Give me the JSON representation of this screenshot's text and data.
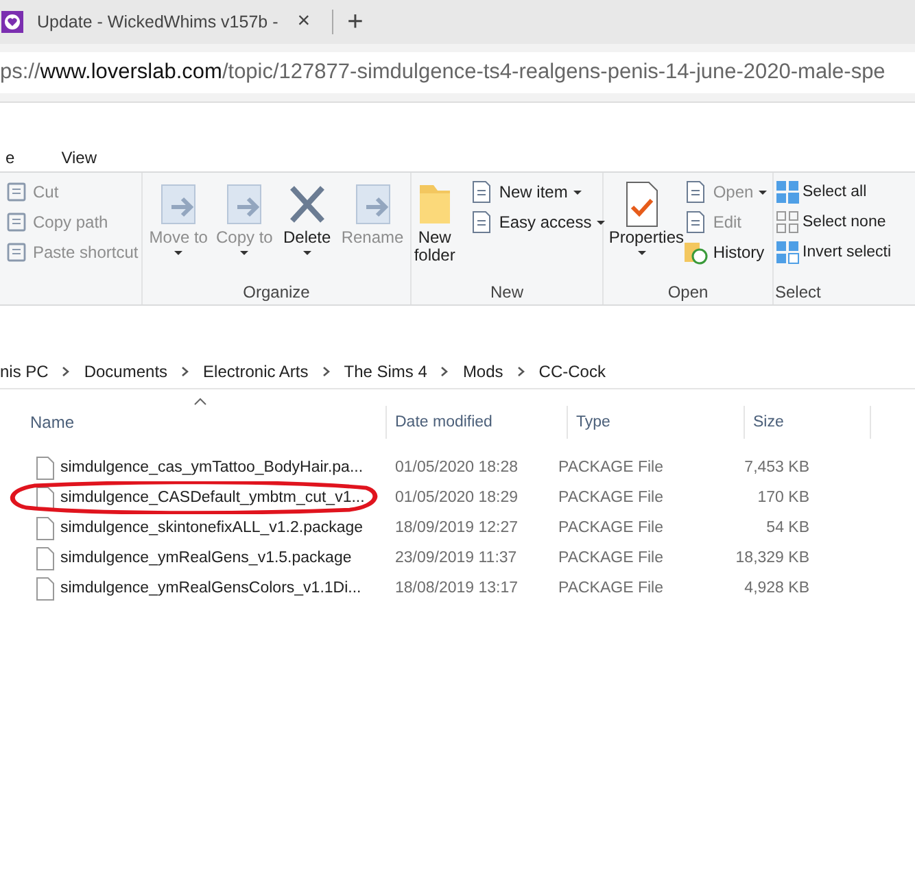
{
  "browser": {
    "tab": {
      "title": "Update - WickedWhims v157b -",
      "close": "×"
    },
    "new_tab": "+",
    "address": {
      "scheme": "ps://",
      "host": "www.loverslab.com",
      "path": "/topic/127877-simdulgence-ts4-realgens-penis-14-june-2020-male-spe"
    }
  },
  "ribbon_tabs": [
    {
      "label": "e",
      "selected": false
    },
    {
      "label": "View",
      "selected": false
    }
  ],
  "ribbon_groups": [
    {
      "items": [
        {
          "kind": "small",
          "label": "Cut",
          "disabled": true
        },
        {
          "kind": "small",
          "label": "Copy path",
          "disabled": true
        },
        {
          "kind": "small",
          "label": "Paste shortcut",
          "disabled": true
        }
      ]
    },
    {
      "label": "Organize",
      "items": [
        {
          "kind": "large",
          "label": "Move to",
          "caret": true,
          "disabled": true
        },
        {
          "kind": "large",
          "label": "Copy to",
          "caret": true,
          "disabled": true
        },
        {
          "kind": "large",
          "label": "Delete",
          "caret": true,
          "disabled": false
        },
        {
          "kind": "large",
          "label": "Rename",
          "caret": false,
          "disabled": true
        }
      ]
    },
    {
      "label": "New",
      "items": [
        {
          "kind": "large",
          "label": "New folder",
          "caret": false,
          "disabled": false
        },
        {
          "kind": "stack",
          "items": [
            {
              "label": "New item",
              "caret": true,
              "disabled": false
            },
            {
              "label": "Easy access",
              "caret": true,
              "disabled": false
            }
          ]
        }
      ]
    },
    {
      "label": "Open",
      "items": [
        {
          "kind": "large",
          "label": "Properties",
          "caret": true,
          "disabled": false
        },
        {
          "kind": "stack",
          "items": [
            {
              "label": "Open",
              "caret": true,
              "disabled": true
            },
            {
              "label": "Edit",
              "caret": false,
              "disabled": true
            },
            {
              "label": "History",
              "caret": false,
              "disabled": false
            }
          ]
        }
      ]
    },
    {
      "label": "Select",
      "items": [
        {
          "kind": "stack",
          "items": [
            {
              "label": "Select all",
              "caret": false,
              "disabled": false
            },
            {
              "label": "Select none",
              "caret": false,
              "disabled": false
            },
            {
              "label": "Invert selecti",
              "caret": false,
              "disabled": false
            }
          ]
        }
      ]
    }
  ],
  "breadcrumb": [
    "nis PC",
    "Documents",
    "Electronic Arts",
    "The Sims 4",
    "Mods",
    "CC-Cock"
  ],
  "table": {
    "columns": [
      "Name",
      "Date modified",
      "Type",
      "Size"
    ],
    "rows": [
      {
        "name": "simdulgence_cas_ymTattoo_BodyHair.pa...",
        "date": "01/05/2020 18:28",
        "type": "PACKAGE File",
        "size": "7,453 KB",
        "circled": false
      },
      {
        "name": "simdulgence_CASDefault_ymbtm_cut_v1...",
        "date": "01/05/2020 18:29",
        "type": "PACKAGE File",
        "size": "170 KB",
        "circled": true
      },
      {
        "name": "simdulgence_skintonefixALL_v1.2.package",
        "date": "18/09/2019 12:27",
        "type": "PACKAGE File",
        "size": "54 KB",
        "circled": false
      },
      {
        "name": "simdulgence_ymRealGens_v1.5.package",
        "date": "23/09/2019 11:37",
        "type": "PACKAGE File",
        "size": "18,329 KB",
        "circled": false
      },
      {
        "name": "simdulgence_ymRealGensColors_v1.1Di...",
        "date": "18/08/2019 13:17",
        "type": "PACKAGE File",
        "size": "4,928 KB",
        "circled": false
      }
    ]
  }
}
